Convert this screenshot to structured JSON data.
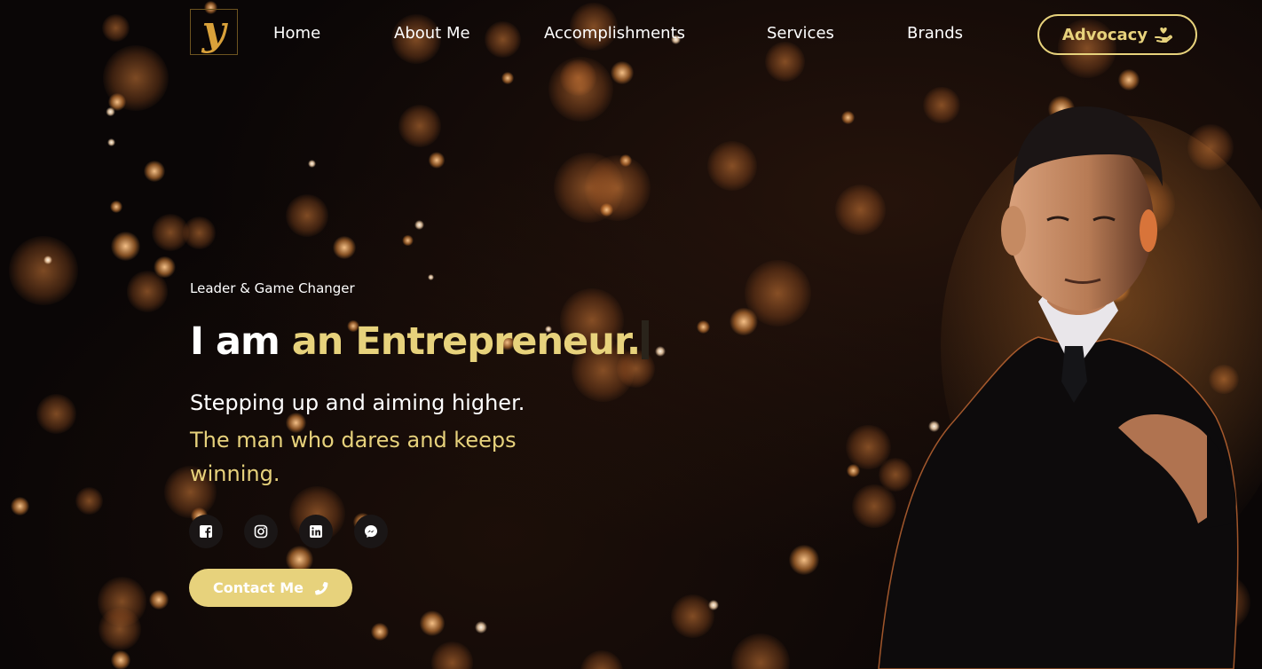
{
  "logo": {
    "letter": "y"
  },
  "nav": {
    "links": [
      "Home",
      "About Me",
      "Accomplishments",
      "Services",
      "Brands"
    ],
    "advocacy_label": "Advocacy",
    "advocacy_icon": "hand-holding-heart-icon"
  },
  "hero": {
    "tagline": "Leader & Game Changer",
    "headline_prefix": "I am",
    "headline_highlight": "an Entrepreneur.",
    "subtitle_line1": "Stepping up and aiming higher.",
    "subtitle_line2": "The man who dares and keeps winning."
  },
  "socials": [
    "facebook-icon",
    "instagram-icon",
    "linkedin-icon",
    "messenger-icon"
  ],
  "cta": {
    "label": "Contact Me",
    "icon": "phone-icon"
  },
  "colors": {
    "accent": "#e7d27c",
    "logo_gold": "#d9a13a",
    "background": "#0a0606"
  }
}
